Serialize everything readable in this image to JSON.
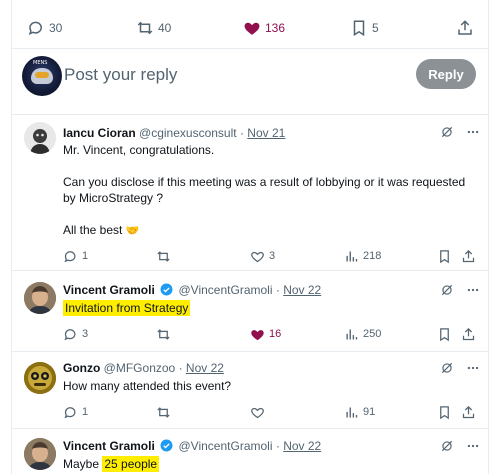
{
  "top_actions": {
    "replies": "30",
    "reposts": "40",
    "likes": "136",
    "bookmarks": "5"
  },
  "reply_box": {
    "placeholder": "Post your reply",
    "button_label": "Reply",
    "avatar_text": "MENS"
  },
  "tweets": [
    {
      "name": "Iancu Cioran",
      "handle": "@cginexusconsult",
      "separator": "·",
      "date": "Nov 21",
      "verified": false,
      "lines": [
        "Mr. Vincent, congratulations.",
        "Can you disclose if this meeting was a result of lobbying or it was requested",
        "by MicroStrategy ?",
        "All the best"
      ],
      "emoji": "🤝",
      "replies": "1",
      "reposts": "",
      "likes": "3",
      "views": "218",
      "liked": false
    },
    {
      "name": "Vincent Gramoli",
      "handle": "@VincentGramoli",
      "separator": "·",
      "date": "Nov 22",
      "verified": true,
      "text": "Invitation from Strategy",
      "replies": "3",
      "reposts": "",
      "likes": "16",
      "views": "250",
      "liked": true
    },
    {
      "name": "Gonzo",
      "handle": "@MFGonzoo",
      "separator": "·",
      "date": "Nov 22",
      "verified": false,
      "text": "How many attended this event?",
      "replies": "1",
      "reposts": "",
      "likes": "",
      "views": "91",
      "liked": false
    },
    {
      "name": "Vincent Gramoli",
      "handle": "@VincentGramoli",
      "separator": "·",
      "date": "Nov 22",
      "verified": true,
      "text_prefix": "Maybe ",
      "text_highlight": "25 people"
    }
  ],
  "colors": {
    "text": "#0f1419",
    "muted": "#536471",
    "like": "#91104d",
    "verified": "#1d9bf0",
    "highlight": "#ffee00",
    "reply_button": "#8c9196"
  }
}
